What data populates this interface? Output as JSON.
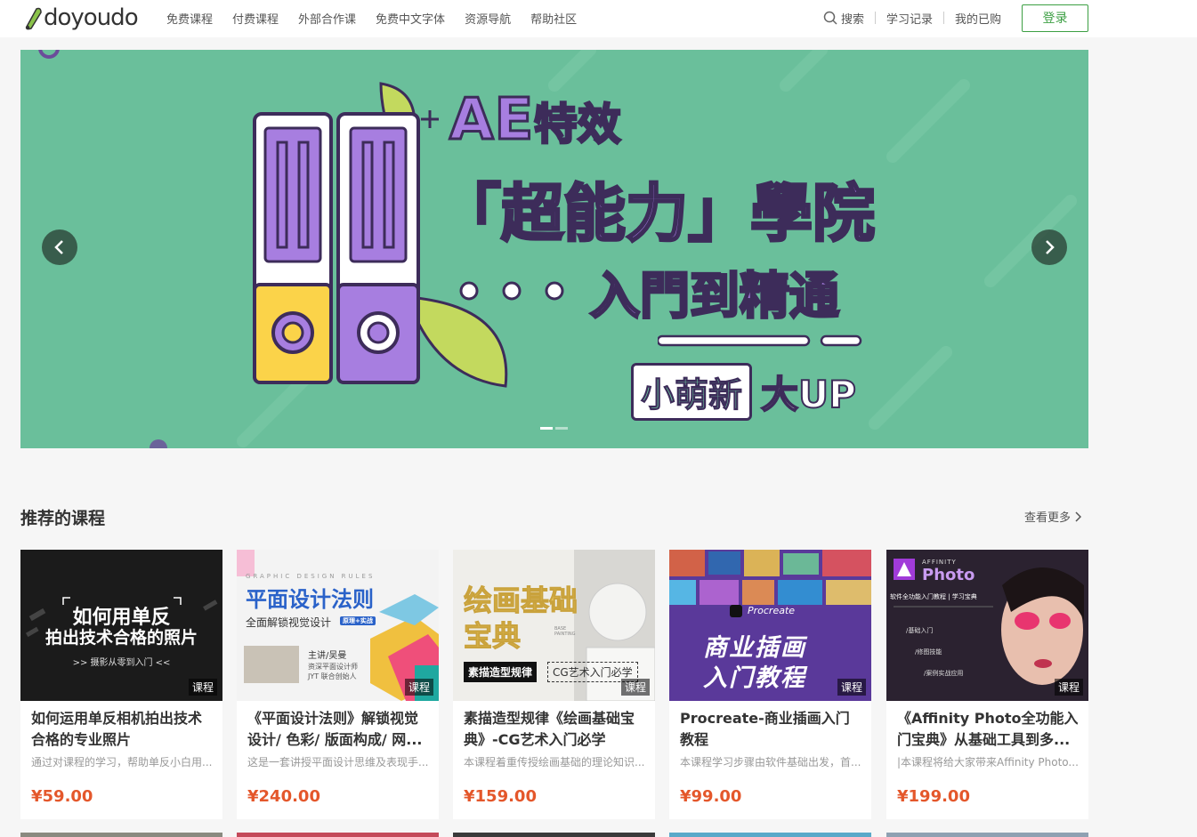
{
  "header": {
    "logo_text": "doyoudo",
    "nav": [
      "免费课程",
      "付费课程",
      "外部合作课",
      "免费中文字体",
      "资源导航",
      "帮助社区"
    ],
    "search_label": "搜索",
    "history_label": "学习记录",
    "purchased_label": "我的已购",
    "login_label": "登录"
  },
  "banner": {
    "line1_latin": "AE",
    "line1_cjk": "特效",
    "line2": "「超能力」學院",
    "line3": "入門到精通",
    "badge": "小萌新",
    "badge_up": "大UP",
    "slide_count": 2,
    "active_slide": 0
  },
  "section": {
    "title": "推荐的课程",
    "see_more": "查看更多"
  },
  "courses": [
    {
      "thumb_lines": [
        "如何用单反",
        "拍出技术合格的照片",
        ">> 摄影从零到入门 <<"
      ],
      "tag": "课程",
      "title": "如何运用单反相机拍出技术合格的专业照片",
      "desc": "通过对课程的学习，帮助单反小白用...",
      "price": "¥59.00"
    },
    {
      "thumb_lines": [
        "GRAPHIC DESIGN RULES",
        "平面设计法则",
        "全面解锁视觉设计",
        "原理+实战",
        "主讲/吴曼",
        "资深平面设计师",
        "JYT 联合创始人"
      ],
      "tag": "课程",
      "title": "《平面设计法则》解锁视觉设计/ 色彩/ 版面构成/ 网...",
      "desc": "这是一套讲授平面设计思维及表现手...",
      "price": "¥240.00"
    },
    {
      "thumb_lines": [
        "绘画基础",
        "宝典",
        "BASE PAINTING",
        "素描造型规律",
        "CG艺术入门必学"
      ],
      "tag": "课程",
      "title": "素描造型规律《绘画基础宝典》-CG艺术入门必学",
      "desc": "本课程着重传授绘画基础的理论知识...",
      "price": "¥159.00"
    },
    {
      "thumb_lines": [
        "Procreate",
        "商业插画",
        "入门教程"
      ],
      "tag": "课程",
      "title": "Procreate-商业插画入门教程",
      "desc": "本课程学习步骤由软件基础出发，首...",
      "price": "¥99.00"
    },
    {
      "thumb_lines": [
        "AFFINITY",
        "Photo",
        "软件全功能入门教程 | 学习宝典",
        "/基础入门",
        "/修图技能",
        "/案例实战应用"
      ],
      "tag": "课程",
      "title": "《Affinity Photo全功能入门宝典》从基础工具到多...",
      "desc": "|本课程将给大家带来Affinity Photo...",
      "price": "¥199.00"
    }
  ],
  "colors": {
    "brand_green": "#3c9f43",
    "banner_bg": "#6abf9b",
    "price_orange": "#e4572b",
    "banner_purple": "#a77ee0"
  }
}
